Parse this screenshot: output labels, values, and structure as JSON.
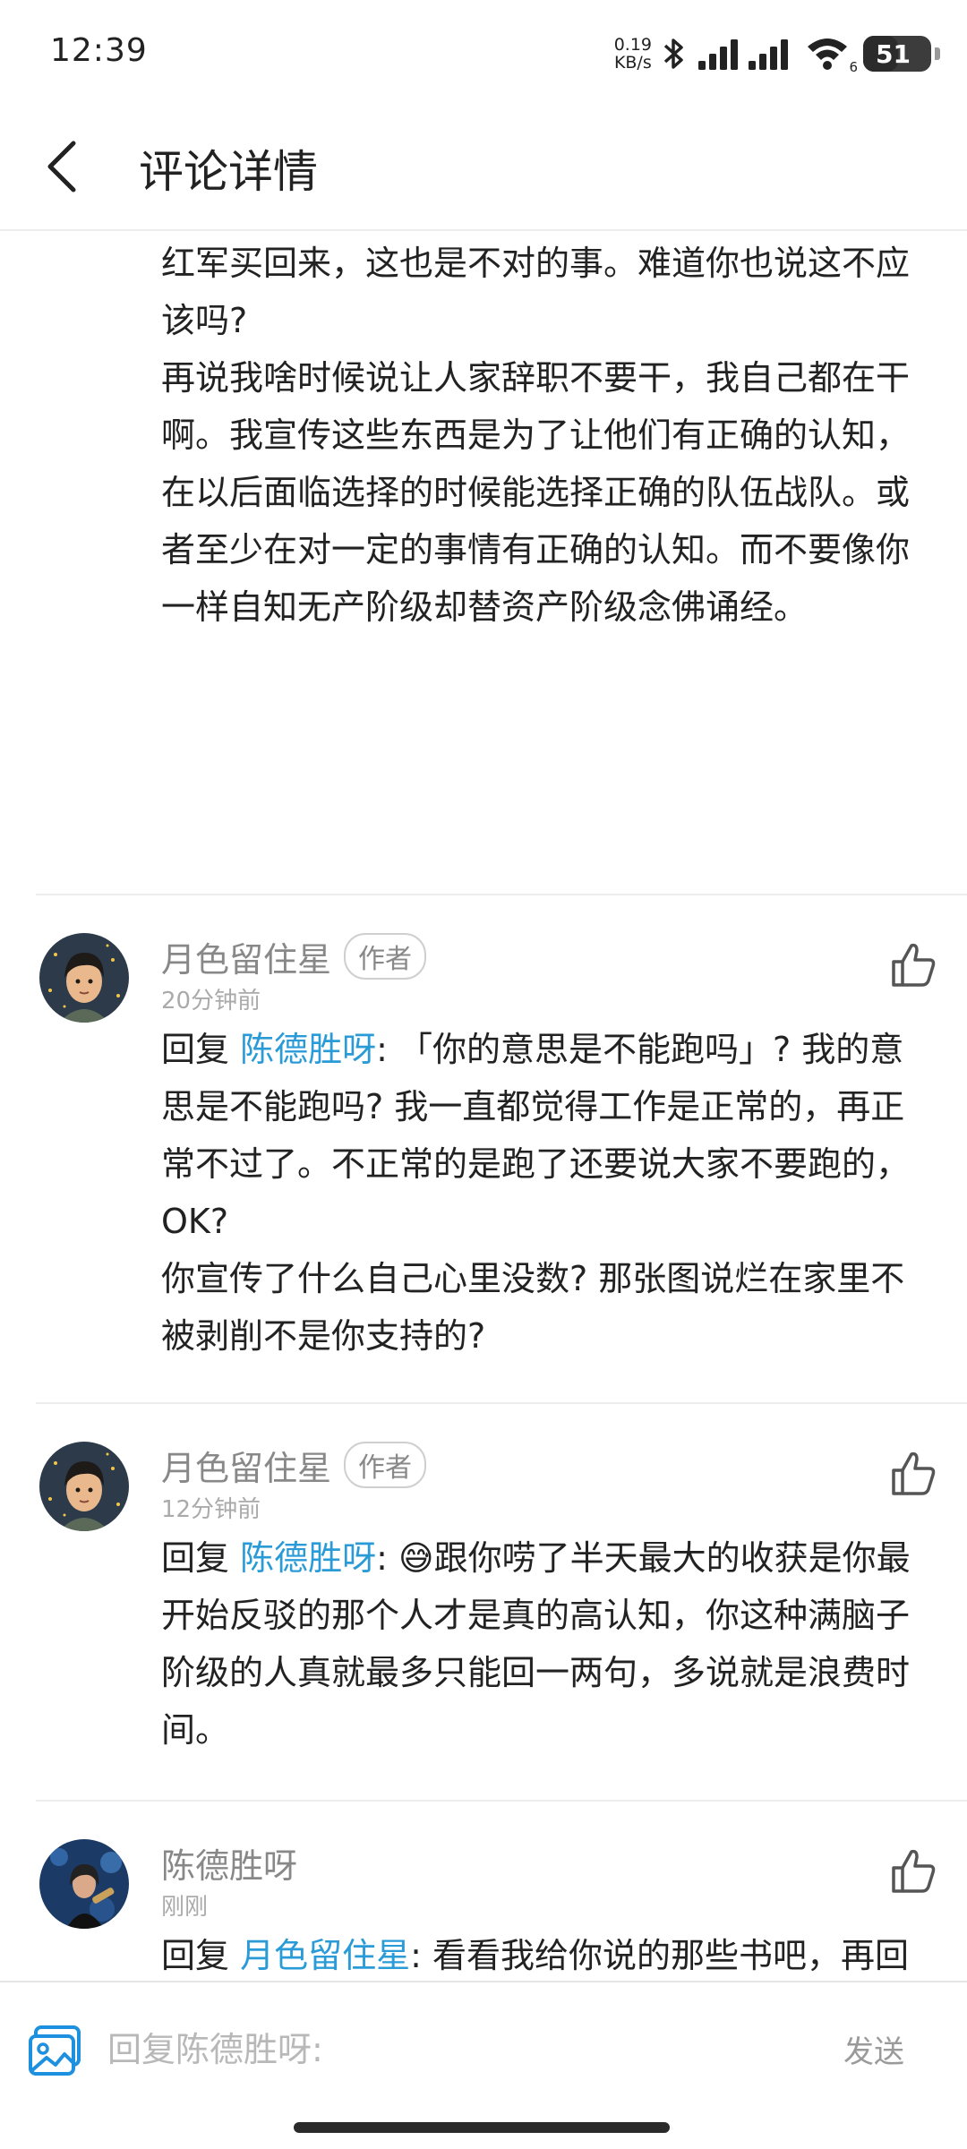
{
  "status_bar": {
    "time": "12:39",
    "net_speed_value": "0.19",
    "net_speed_unit": "KB/s",
    "wifi_label": "6",
    "battery": "51",
    "battery_level_percent": 51
  },
  "header": {
    "title": "评论详情"
  },
  "top_comment": {
    "text": "红军买回来，这也是不对的事。难道你也说这不应该吗?\n再说我啥时候说让人家辞职不要干，我自己都在干啊。我宣传这些东西是为了让他们有正确的认知，在以后面临选择的时候能选择正确的队伍战队。或者至少在对一定的事情有正确的认知。而不要像你一样自知无产阶级却替资产阶级念佛诵经。"
  },
  "comments": [
    {
      "author": "月色留住星",
      "badge": "作者",
      "time": "20分钟前",
      "reply_prefix": "回复 ",
      "mention": "陈德胜呀",
      "text": ": 「你的意思是不能跑吗」? 我的意思是不能跑吗? 我一直都觉得工作是正常的，再正常不过了。不正常的是跑了还要说大家不要跑的，OK?\n你宣传了什么自己心里没数? 那张图说烂在家里不被剥削不是你支持的?"
    },
    {
      "author": "月色留住星",
      "badge": "作者",
      "time": "12分钟前",
      "reply_prefix": "回复 ",
      "mention": "陈德胜呀",
      "text": ": 😅跟你唠了半天最大的收获是你最开始反驳的那个人才是真的高认知，你这种满脑子阶级的人真就最多只能回一两句，多说就是浪费时间。"
    },
    {
      "author": "陈德胜呀",
      "badge": "",
      "time": "刚刚",
      "reply_prefix": "回复 ",
      "mention": "月色留住星",
      "text": ": 看看我给你说的那些书吧，再回头看你这些言论，你自有认知。"
    }
  ],
  "reply_bar": {
    "placeholder": "回复陈德胜呀:",
    "send_label": "发送"
  },
  "colors": {
    "mention": "#2a9bd6",
    "accent_icon": "#1e90e0",
    "meta_text": "#888888"
  },
  "icons": [
    "back-arrow-icon",
    "bluetooth-icon",
    "signal-icon",
    "wifi-icon",
    "battery-icon",
    "thumbs-up-icon",
    "image-icon"
  ]
}
